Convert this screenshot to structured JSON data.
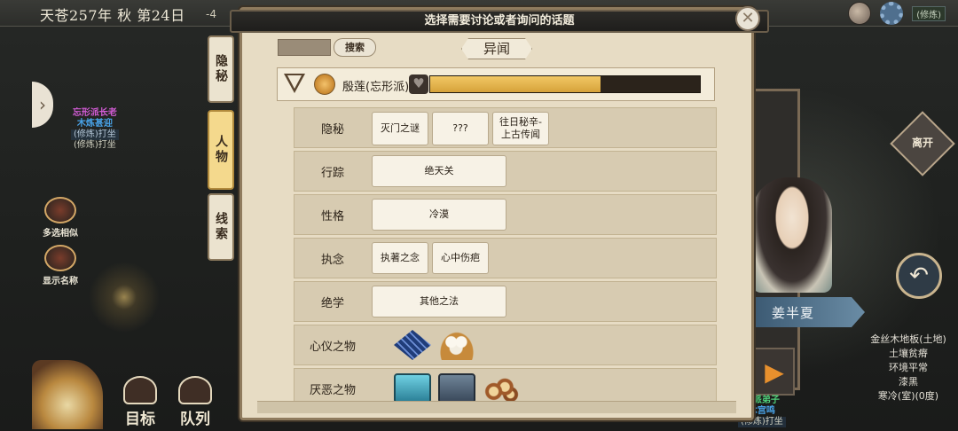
{
  "status": {
    "date": "天苍257年 秋 第24日",
    "top_dots": "-4",
    "right_status": "(修炼)"
  },
  "left": {
    "npc": {
      "line1": "忘形派长老",
      "line2": "木炼甚迎",
      "line3": "(修炼)打坐",
      "line4": "(修炼)打坐"
    },
    "multi_select": "多选相似",
    "show_names": "显示名称",
    "goal": "目标",
    "team": "队列"
  },
  "right": {
    "npc_name": "姜半夏",
    "leave": "离开",
    "tile_info": [
      "金丝木地板(土地)",
      "土壤贫瘠",
      "环境平常",
      "漆黑",
      "寒冷(室)(0度)"
    ],
    "npc_bottom": {
      "line1": "忘派弟子",
      "line2": "木宫鸣",
      "line3": "(修炼)打坐"
    }
  },
  "category_tabs": [
    {
      "label": "隐秘",
      "active": false
    },
    {
      "label": "人物",
      "active": true
    },
    {
      "label": "线索",
      "active": false
    }
  ],
  "dialog": {
    "title": "选择需要讨论或者询问的话题",
    "close": "✕",
    "search_label": "搜索",
    "section": "异闻",
    "person": {
      "name": "殷莲(忘形派)",
      "favor": 0.63
    },
    "rows": [
      {
        "label": "隐秘",
        "chips": [
          "灭门之谜",
          "???",
          "往日秘辛-上古传闻"
        ]
      },
      {
        "label": "行踪",
        "chips": [
          "绝天关"
        ]
      },
      {
        "label": "性格",
        "chips": [
          "冷漠"
        ]
      },
      {
        "label": "执念",
        "chips": [
          "执著之念",
          "心中伤疤"
        ]
      },
      {
        "label": "绝学",
        "chips": [
          "其他之法"
        ]
      },
      {
        "label": "心仪之物",
        "items": [
          "blue-cloth",
          "steamed-buns"
        ]
      },
      {
        "label": "厌恶之物",
        "items": [
          "cyan-stone-slab",
          "gray-stone-slab",
          "wood-logs"
        ]
      }
    ]
  }
}
